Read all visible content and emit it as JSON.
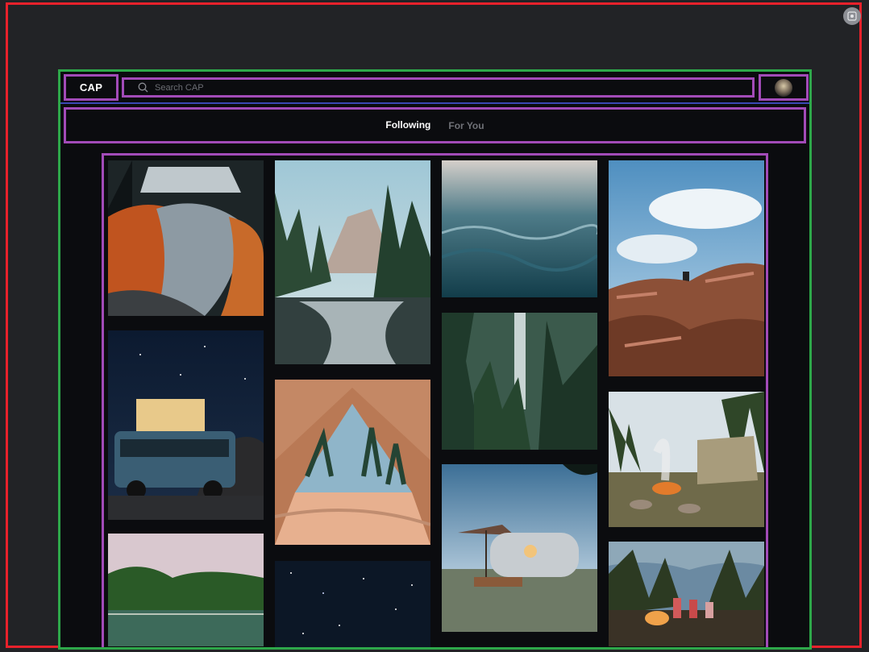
{
  "app": {
    "logo": "CAP"
  },
  "search": {
    "placeholder": "Search CAP",
    "icon": "search-icon"
  },
  "user": {
    "avatar_icon": "avatar"
  },
  "tabs": [
    {
      "label": "Following",
      "active": true
    },
    {
      "label": "For You",
      "active": false
    }
  ],
  "colors": {
    "background": "#222326",
    "panel": "#0b0c0f",
    "text_active": "#ffffff",
    "text_inactive": "#6f7177"
  },
  "feed": {
    "pins": [
      {
        "subject": "sleeping bags in car"
      },
      {
        "subject": "mountain valley river with pines"
      },
      {
        "subject": "ocean waves at dusk"
      },
      {
        "subject": "person sitting on red rocks"
      },
      {
        "subject": "camper van under starry sky"
      },
      {
        "subject": "view from inside tent to forest"
      },
      {
        "subject": "waterfall in pine forest"
      },
      {
        "subject": "campfire and tent camp"
      },
      {
        "subject": "lake with forest shore"
      },
      {
        "subject": "night sky with stars"
      },
      {
        "subject": "vintage trailer with umbrella"
      },
      {
        "subject": "group around campfire"
      }
    ]
  }
}
